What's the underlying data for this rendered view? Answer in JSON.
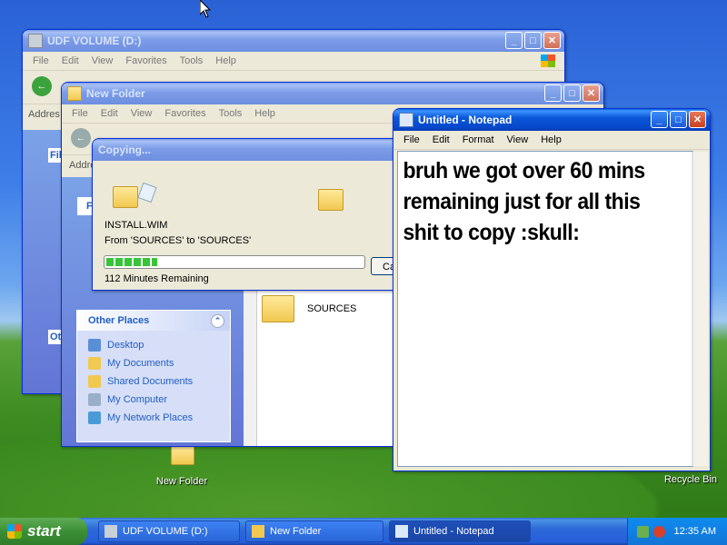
{
  "desktop": {
    "icons": [
      {
        "label": "New Folder"
      },
      {
        "label": "Recycle Bin"
      }
    ]
  },
  "win_udf": {
    "title": "UDF VOLUME (D:)",
    "menu": [
      "File",
      "Edit",
      "View",
      "Favorites",
      "Tools",
      "Help"
    ],
    "address_label": "Addres",
    "pane_labels": [
      "File",
      "Oth"
    ]
  },
  "win_newfolder": {
    "title": "New Folder",
    "menu": [
      "File",
      "Edit",
      "View",
      "Favorites",
      "Tools",
      "Help"
    ],
    "address_label": "Addre",
    "pane_label": "F",
    "other_places": {
      "heading": "Other Places",
      "items": [
        "Desktop",
        "My Documents",
        "Shared Documents",
        "My Computer",
        "My Network Places"
      ]
    },
    "files": [
      {
        "name": "SOURCES"
      }
    ]
  },
  "copy_dialog": {
    "title": "Copying...",
    "filename": "INSTALL.WIM",
    "from_to": "From 'SOURCES' to 'SOURCES'",
    "progress": 0.2,
    "remaining": "112 Minutes Remaining",
    "cancel_label": "Ca"
  },
  "notepad": {
    "title": "Untitled - Notepad",
    "menu": [
      "File",
      "Edit",
      "Format",
      "View",
      "Help"
    ],
    "text_lines": [
      "bruh we got over 60 mins",
      "remaining just for all this",
      "shit to copy :skull:"
    ]
  },
  "taskbar": {
    "start_label": "start",
    "tasks": [
      {
        "label": "UDF VOLUME (D:)"
      },
      {
        "label": "New Folder"
      },
      {
        "label": "Untitled - Notepad"
      }
    ],
    "clock": "12:35 AM"
  }
}
